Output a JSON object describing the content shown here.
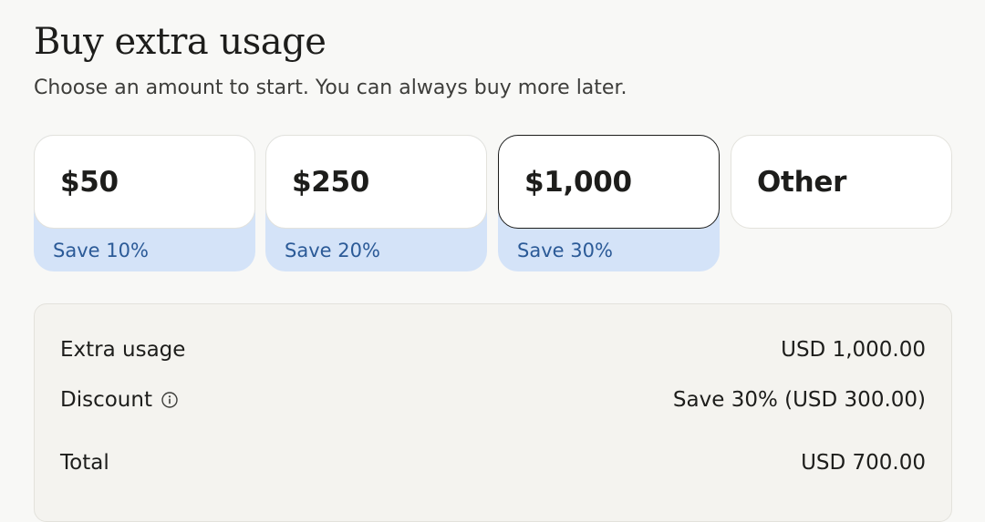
{
  "header": {
    "title": "Buy extra usage",
    "subtitle": "Choose an amount to start. You can always buy more later."
  },
  "options": [
    {
      "amount": "$50",
      "discount": "Save 10%",
      "selected": false
    },
    {
      "amount": "$250",
      "discount": "Save 20%",
      "selected": false
    },
    {
      "amount": "$1,000",
      "discount": "Save 30%",
      "selected": true
    },
    {
      "amount": "Other",
      "discount": "",
      "selected": false
    }
  ],
  "summary": {
    "extra_usage_label": "Extra usage",
    "extra_usage_value": "USD 1,000.00",
    "discount_label": "Discount",
    "discount_value": "Save 30% (USD 300.00)",
    "total_label": "Total",
    "total_value": "USD 700.00"
  },
  "colors": {
    "background": "#f8f8f6",
    "discount_band": "#d4e3f8",
    "discount_text": "#2b5a97",
    "selected_border": "#1d1d1b"
  }
}
